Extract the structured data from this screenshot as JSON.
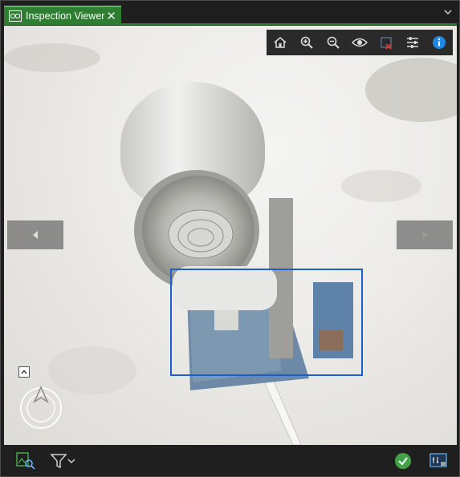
{
  "window": {
    "tab_title": "Inspection Viewer"
  },
  "toolbar": {
    "items": [
      {
        "name": "home-icon"
      },
      {
        "name": "zoom-in-icon"
      },
      {
        "name": "zoom-out-icon"
      },
      {
        "name": "eye-icon"
      },
      {
        "name": "crop-clear-icon"
      },
      {
        "name": "adjust-sliders-icon"
      },
      {
        "name": "info-icon"
      }
    ]
  },
  "colors": {
    "tab_active": "#2f7d32",
    "selection_box": "#1a5fd0",
    "info_blue": "#1e88e5",
    "ok_green": "#43a047"
  }
}
